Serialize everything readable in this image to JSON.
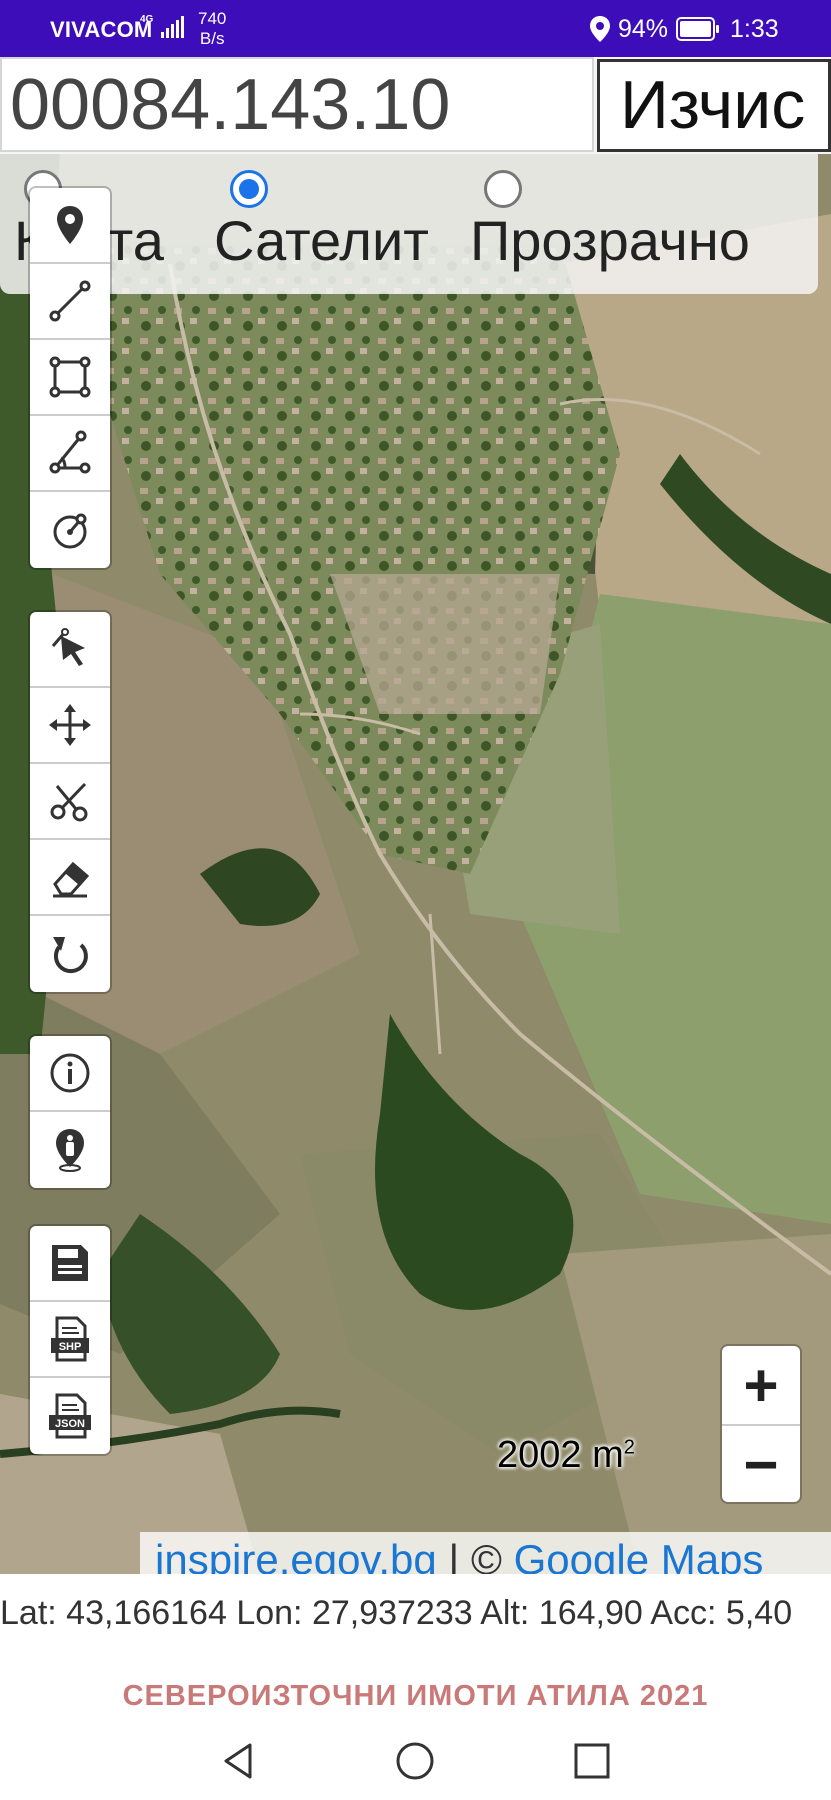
{
  "status_bar": {
    "carrier": "VIVACOM",
    "network": "4G",
    "speed_value": "740",
    "speed_unit": "B/s",
    "battery_percent": "94%",
    "time": "1:33"
  },
  "topbar": {
    "parcel_id_value": "00084.143.10",
    "calculate_button": "Изчис"
  },
  "layers": {
    "options": [
      "Карта",
      "Сателит",
      "Прозрачно"
    ],
    "selected": "Сателит"
  },
  "tools": {
    "draw_group": [
      "marker-icon",
      "line-icon",
      "polygon-icon",
      "angle-icon",
      "circle-icon"
    ],
    "edit_group": [
      "select-icon",
      "move-icon",
      "cut-icon",
      "eraser-icon",
      "rotate-icon"
    ],
    "info_group": [
      "info-icon",
      "my-location-icon"
    ],
    "export_group": [
      "save-icon",
      "shp-icon",
      "json-icon"
    ]
  },
  "map": {
    "area_value": "2002 m",
    "area_unit_sup": "2",
    "attribution_link1": "inspire.egov.bg",
    "attribution_sep": " | © ",
    "attribution_link2": "Google Maps",
    "zoom_in": "+",
    "zoom_out": "−"
  },
  "info": {
    "coordinates": "Lat: 43,166164 Lon: 27,937233 Alt: 164,90 Acc: 5,40",
    "footer_title": "СЕВЕРОИЗТОЧНИ ИМОТИ АТИЛА 2021"
  },
  "colors": {
    "status_bar": "#3D0DBA",
    "radio_selected": "#1a73e8",
    "footer_title": "#c97a78",
    "link": "#1976d2"
  }
}
